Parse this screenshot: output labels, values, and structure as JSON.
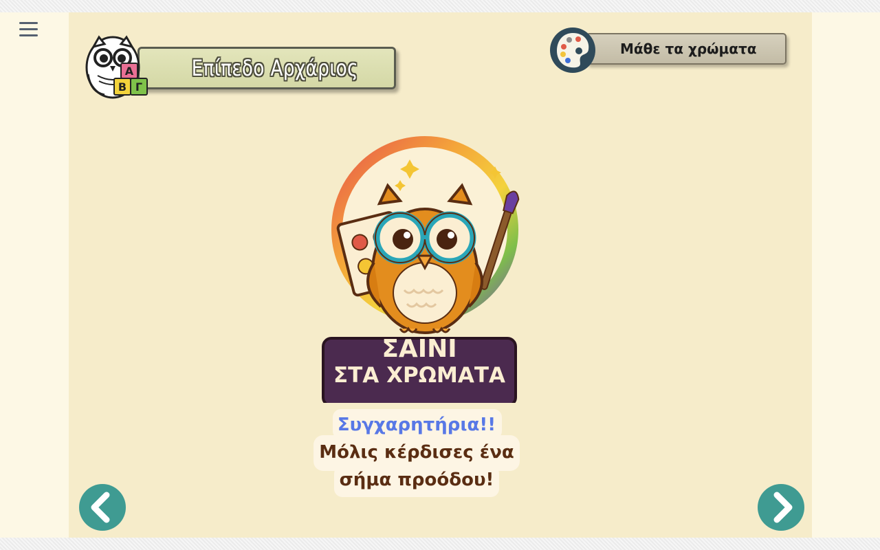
{
  "menu": {
    "icon": "hamburger-menu-icon"
  },
  "header": {
    "level_label": "Επίπεδο Αρχάριος",
    "level_icon": "owl-abc-blocks-icon",
    "level_blocks": [
      "Α",
      "Β",
      "Γ"
    ],
    "colors_label": "Μάθε τα χρώματα",
    "colors_icon": "palette-icon"
  },
  "badge": {
    "line1": "ΣΑΙΝΙ",
    "line2": "ΣΤΑ ΧΡΩΜΑΤΑ",
    "icon": "owl-painter-badge-icon"
  },
  "message": {
    "title": "Συγχαρητήρια!!",
    "line2": "Μόλις κέρδισες ένα",
    "line3": "σήμα προόδου!"
  },
  "nav": {
    "prev_icon": "chevron-left-icon",
    "next_icon": "chevron-right-icon"
  },
  "colors": {
    "accent": "#3f9b92",
    "stage": "#f6ecca",
    "banner": "#4b2a4f",
    "congrats": "#5878e6"
  }
}
